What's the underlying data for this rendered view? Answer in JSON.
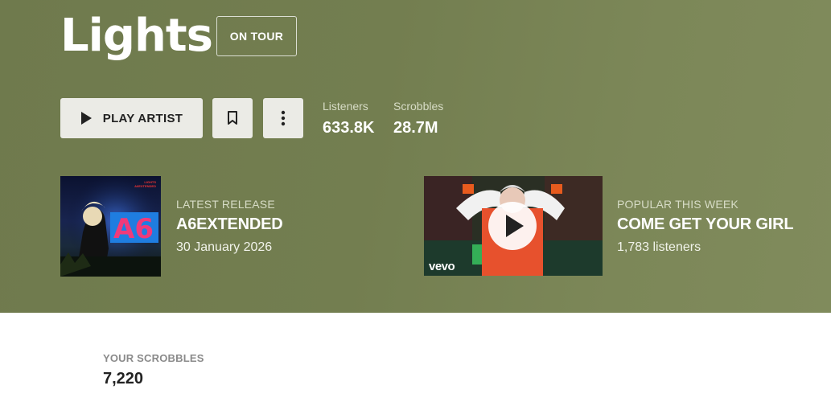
{
  "artist": {
    "name": "Lights",
    "tour_badge": "ON TOUR"
  },
  "actions": {
    "play_label": "PLAY ARTIST",
    "play_icon": "play-icon",
    "bookmark_icon": "bookmark-icon",
    "more_icon": "more-vertical-icon"
  },
  "stats": {
    "listeners_label": "Listeners",
    "listeners_value": "633.8K",
    "scrobbles_label": "Scrobbles",
    "scrobbles_value": "28.7M"
  },
  "latest_release": {
    "kicker": "LATEST RELEASE",
    "title": "A6EXTENDED",
    "date": "30 January 2026",
    "cover_text_artist": "LIGHTS",
    "cover_text_album": "A6EXTENDED",
    "cover_big_text": "A6"
  },
  "popular": {
    "kicker": "POPULAR THIS WEEK",
    "title": "COME GET YOUR GIRL",
    "listeners": "1,783 listeners",
    "video_logo": "vevo"
  },
  "your_scrobbles": {
    "label": "YOUR SCROBBLES",
    "value": "7,220"
  },
  "colors": {
    "hero_bg": "#737e50",
    "button_bg": "#ebebe6",
    "muted_label": "#d7dcc6"
  }
}
